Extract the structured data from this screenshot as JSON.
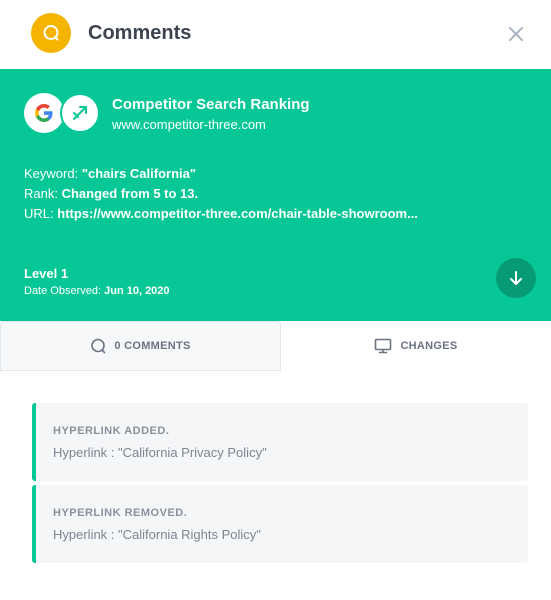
{
  "header": {
    "title": "Comments"
  },
  "banner": {
    "title": "Competitor Search Ranking",
    "site": "www.competitor-three.com",
    "keyword_label": "Keyword:",
    "keyword_value": "\"chairs California\"",
    "rank_label": "Rank:",
    "rank_value": "Changed from 5 to 13.",
    "url_label": "URL:",
    "url_value": "https://www.competitor-three.com/chair-table-showroom...",
    "level": "Level 1",
    "date_label": "Date Observed:",
    "date_value": "Jun 10, 2020"
  },
  "tabs": [
    {
      "label": "0 COMMENTS",
      "icon": "comment-icon",
      "active": false
    },
    {
      "label": "CHANGES",
      "icon": "monitor-icon",
      "active": true
    }
  ],
  "changes": [
    {
      "title": "HYPERLINK ADDED.",
      "body": "Hyperlink : \"California Privacy Policy\""
    },
    {
      "title": "HYPERLINK REMOVED.",
      "body": "Hyperlink : \"California Rights Policy\""
    }
  ],
  "colors": {
    "accent": "#07c796",
    "accent_dark": "#069b75",
    "header_icon": "#f5b400"
  }
}
